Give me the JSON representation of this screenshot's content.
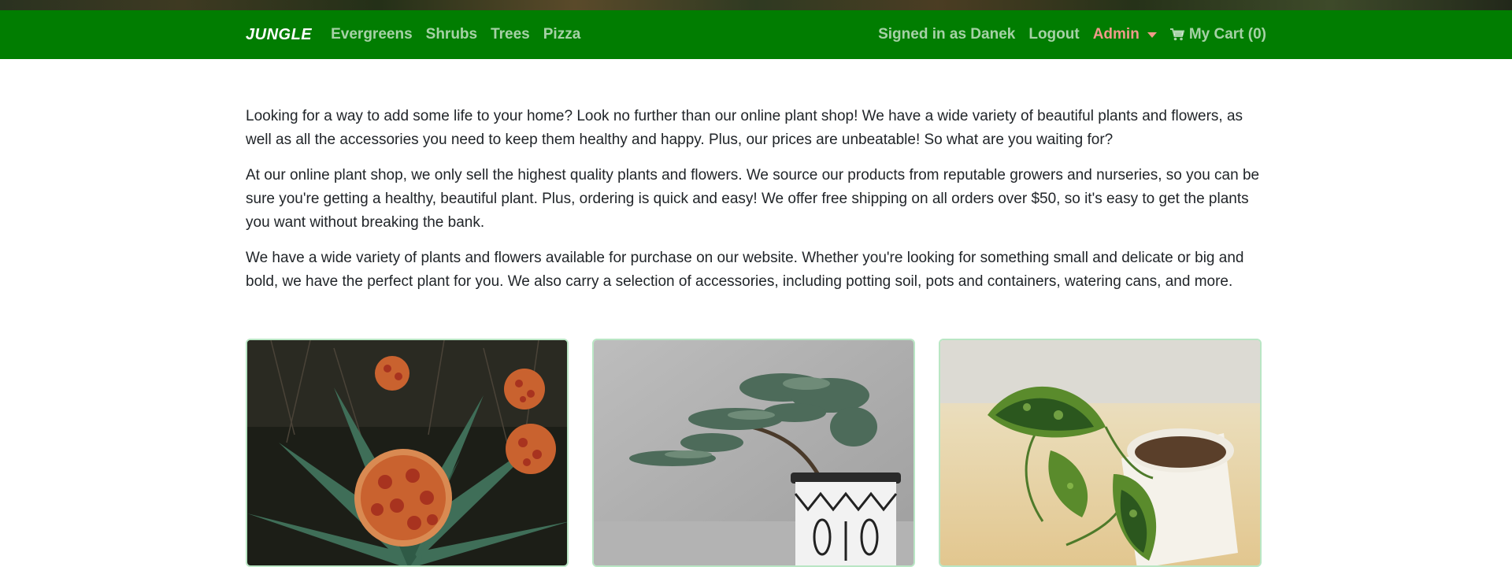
{
  "nav": {
    "brand": "JUNGLE",
    "links": [
      "Evergreens",
      "Shrubs",
      "Trees",
      "Pizza"
    ],
    "signed_in": "Signed in as Danek",
    "logout": "Logout",
    "admin": "Admin",
    "cart": "My Cart (0)",
    "icons": {
      "cart": "cart-icon",
      "admin_caret": "caret-down-icon"
    },
    "colors": {
      "navbar": "#017d01",
      "admin": "#f09a8a",
      "link": "rgba(255,255,255,0.65)"
    }
  },
  "intro": {
    "paragraphs": [
      "Looking for a way to add some life to your home? Look no further than our online plant shop! We have a wide variety of beautiful plants and flowers, as well as all the accessories you need to keep them healthy and happy. Plus, our prices are unbeatable! So what are you waiting for?",
      "At our online plant shop, we only sell the highest quality plants and flowers. We source our products from reputable growers and nurseries, so you can be sure you're getting a healthy, beautiful plant. Plus, ordering is quick and easy! We offer free shipping on all orders over $50, so it's easy to get the plants you want without breaking the bank.",
      "We have a wide variety of plants and flowers available for purchase on our website. Whether you're looking for something small and delicate or big and bold, we have the perfect plant for you. We also carry a selection of accessories, including potting soil, pots and containers, watering cans, and more."
    ]
  },
  "products": [
    {
      "image": "pizza-agave-image"
    },
    {
      "image": "bonsai-juniper-image"
    },
    {
      "image": "pothos-plant-image"
    }
  ]
}
